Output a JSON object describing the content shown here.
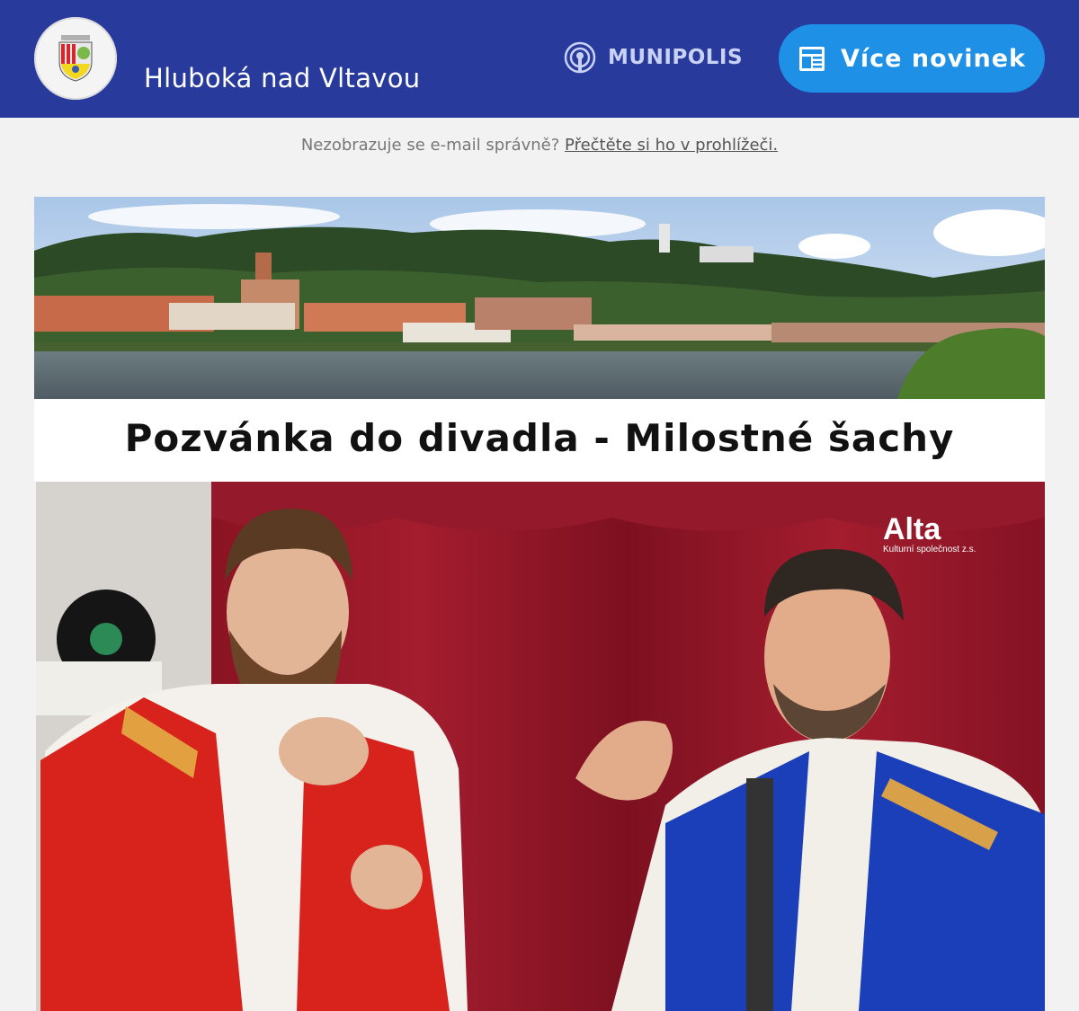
{
  "header": {
    "town_name": "Hluboká nad Vltavou",
    "logo_icon": "town-coat-of-arms",
    "platform_name": "MUNIPOLIS",
    "platform_icon": "broadcast-icon",
    "more_news_label": "Více novinek",
    "more_news_icon": "newspaper-icon",
    "background_color": "#283a9b",
    "button_color": "#1e90e6"
  },
  "browser_note": {
    "text": "Nezobrazuje se e-mail správně?",
    "link": "Přečtěte si ho v prohlížeči."
  },
  "article": {
    "title": "Pozvánka do divadla - Milostné šachy",
    "photo_logo_text": "Alta",
    "photo_logo_subtext": "Kulturní společnost z.s."
  }
}
